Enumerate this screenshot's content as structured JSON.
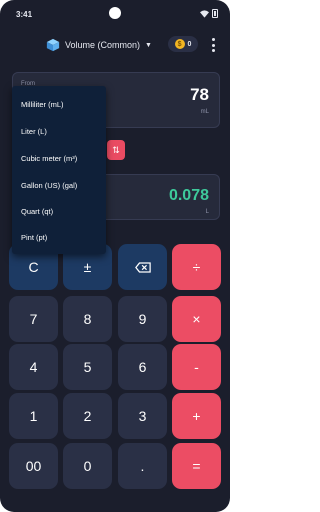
{
  "status_bar": {
    "time": "3:41"
  },
  "appbar": {
    "category_label": "Volume (Common)",
    "category_icon": "cube-icon",
    "coins": "0",
    "coin_glyph": "$"
  },
  "from_card": {
    "caption": "From",
    "value": "78",
    "unit": "mL"
  },
  "to_card": {
    "value": "0.078",
    "unit": "L"
  },
  "swap_glyph": "⇅",
  "dropdown": {
    "items": [
      "Milliliter (mL)",
      "Liter (L)",
      "Cubic meter (m³)",
      "Gallon (US) (gal)",
      "Quart (qt)",
      "Pint (pt)"
    ]
  },
  "keypad": {
    "clear": "C",
    "plus_minus": "±",
    "divide": "÷",
    "seven": "7",
    "eight": "8",
    "nine": "9",
    "multiply": "×",
    "four": "4",
    "five": "5",
    "six": "6",
    "minus": "-",
    "one": "1",
    "two": "2",
    "three": "3",
    "plus": "+",
    "double_zero": "00",
    "zero": "0",
    "decimal": ".",
    "equals": "="
  },
  "colors": {
    "background": "#1b1e2c",
    "key_gray": "#2a3046",
    "key_blue": "#1d3a63",
    "accent_red": "#ec4d64",
    "result_green": "#3ec99b",
    "menu": "#0f2039"
  }
}
